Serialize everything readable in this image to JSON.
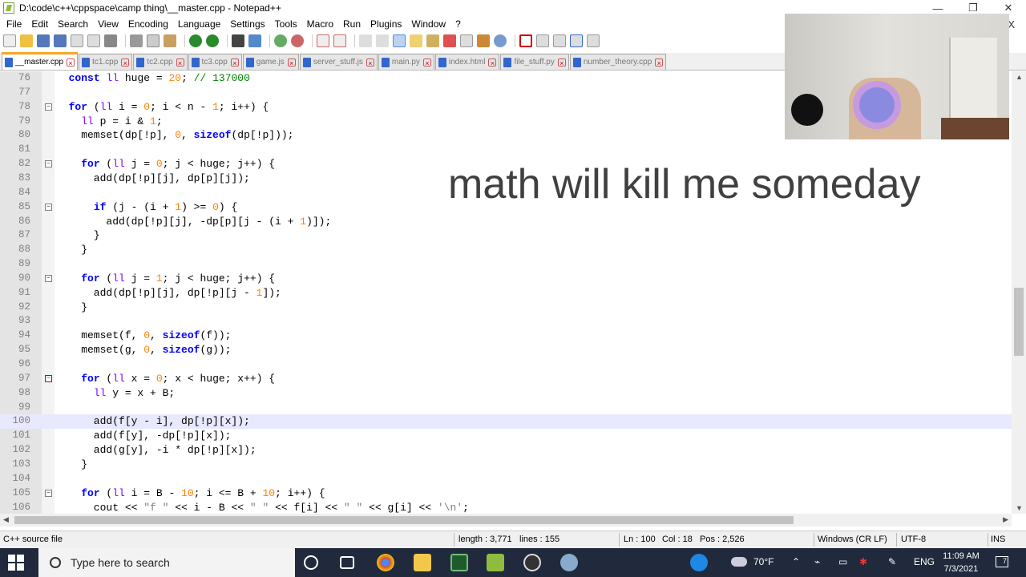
{
  "window": {
    "title": "D:\\code\\c++\\cppspace\\camp thing\\__master.cpp - Notepad++",
    "controls": [
      "—",
      "❐",
      "✕"
    ]
  },
  "menu": [
    "File",
    "Edit",
    "Search",
    "View",
    "Encoding",
    "Language",
    "Settings",
    "Tools",
    "Macro",
    "Run",
    "Plugins",
    "Window",
    "?"
  ],
  "menu_close": "X",
  "tabs": [
    {
      "label": "__master.cpp",
      "active": true
    },
    {
      "label": "tc1.cpp"
    },
    {
      "label": "tc2.cpp"
    },
    {
      "label": "tc3.cpp"
    },
    {
      "label": "game.js"
    },
    {
      "label": "server_stuff.js"
    },
    {
      "label": "main.py"
    },
    {
      "label": "index.html"
    },
    {
      "label": "file_stuff.py"
    },
    {
      "label": "number_theory.cpp"
    }
  ],
  "code": [
    {
      "n": "76",
      "t": "  const ll huge = 20; // 137000"
    },
    {
      "n": "77",
      "t": ""
    },
    {
      "n": "78",
      "t": "  for (ll i = 0; i < n - 1; i++) {"
    },
    {
      "n": "79",
      "t": "    ll p = i & 1;"
    },
    {
      "n": "80",
      "t": "    memset(dp[!p], 0, sizeof(dp[!p]));"
    },
    {
      "n": "81",
      "t": ""
    },
    {
      "n": "82",
      "t": "    for (ll j = 0; j < huge; j++) {"
    },
    {
      "n": "83",
      "t": "      add(dp[!p][j], dp[p][j]);"
    },
    {
      "n": "84",
      "t": ""
    },
    {
      "n": "85",
      "t": "      if (j - (i + 1) >= 0) {"
    },
    {
      "n": "86",
      "t": "        add(dp[!p][j], -dp[p][j - (i + 1)]);"
    },
    {
      "n": "87",
      "t": "      }"
    },
    {
      "n": "88",
      "t": "    }"
    },
    {
      "n": "89",
      "t": ""
    },
    {
      "n": "90",
      "t": "    for (ll j = 1; j < huge; j++) {"
    },
    {
      "n": "91",
      "t": "      add(dp[!p][j], dp[!p][j - 1]);"
    },
    {
      "n": "92",
      "t": "    }"
    },
    {
      "n": "93",
      "t": ""
    },
    {
      "n": "94",
      "t": "    memset(f, 0, sizeof(f));"
    },
    {
      "n": "95",
      "t": "    memset(g, 0, sizeof(g));"
    },
    {
      "n": "96",
      "t": ""
    },
    {
      "n": "97",
      "t": "    for (ll x = 0; x < huge; x++) {"
    },
    {
      "n": "98",
      "t": "      ll y = x + B;"
    },
    {
      "n": "99",
      "t": ""
    },
    {
      "n": "100",
      "t": "      add(f[y - i], dp[!p][x]);"
    },
    {
      "n": "101",
      "t": "      add(f[y], -dp[!p][x]);"
    },
    {
      "n": "102",
      "t": "      add(g[y], -i * dp[!p][x]);"
    },
    {
      "n": "103",
      "t": "    }"
    },
    {
      "n": "104",
      "t": ""
    },
    {
      "n": "105",
      "t": "    for (ll i = B - 10; i <= B + 10; i++) {"
    },
    {
      "n": "106",
      "t": "      cout << \"f \" << i - B << \" \" << f[i] << \" \" << g[i] << '\\n';"
    }
  ],
  "overlay_text": "math will kill me someday",
  "status": {
    "file_type": "C++ source file",
    "length": "length : 3,771",
    "lines": "lines : 155",
    "ln": "Ln : 100",
    "col": "Col : 18",
    "pos": "Pos : 2,526",
    "eol": "Windows (CR LF)",
    "encoding": "UTF-8",
    "mode": "INS"
  },
  "taskbar": {
    "search_placeholder": "Type here to search",
    "temperature": "70°F",
    "language": "ENG",
    "time": "11:09 AM",
    "date": "7/3/2021",
    "notification_count": "7"
  }
}
